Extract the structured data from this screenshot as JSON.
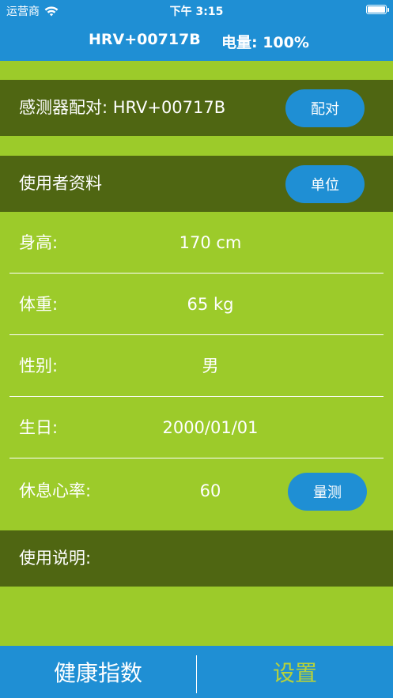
{
  "status_bar": {
    "carrier": "运营商",
    "time": "下午 3:15"
  },
  "header": {
    "device": "HRV+00717B",
    "battery": "电量: 100%"
  },
  "pairing": {
    "label": "感测器配对: HRV+00717B",
    "button": "配对"
  },
  "profile": {
    "title": "使用者资料",
    "unit_button": "单位"
  },
  "fields": [
    {
      "label": "身高:",
      "value": "170 cm"
    },
    {
      "label": "体重:",
      "value": "65 kg"
    },
    {
      "label": "性别:",
      "value": "男"
    },
    {
      "label": "生日:",
      "value": "2000/01/01"
    },
    {
      "label": "休息心率:",
      "value": "60",
      "button": "量测"
    }
  ],
  "instructions": {
    "label": "使用说明:"
  },
  "tabs": [
    {
      "label": "健康指数",
      "active": false
    },
    {
      "label": "设置",
      "active": true
    }
  ],
  "colors": {
    "header_blue": "#1f8fd4",
    "background_green": "#9ccb2a",
    "band_dark_green": "#4f6612",
    "active_tab_text": "#b7d23a"
  }
}
